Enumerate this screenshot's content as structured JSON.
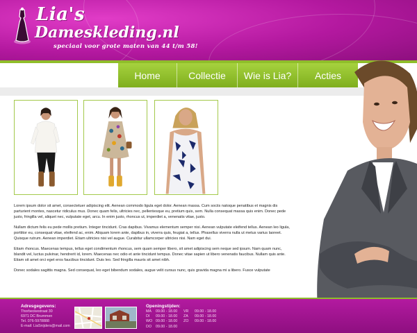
{
  "brand": {
    "name": "Lia's",
    "domain": "Dameskleding.nl",
    "tagline": "speciaal voor grote maten van 44 t/m 58!",
    "colors": {
      "primary": "#b3189f",
      "accent": "#8fbd2a"
    }
  },
  "nav": {
    "items": [
      {
        "label": "Home"
      },
      {
        "label": "Collectie"
      },
      {
        "label": "Wie is Lia?"
      },
      {
        "label": "Acties"
      }
    ]
  },
  "content": {
    "paragraphs": [
      "Lorem ipsum dolor sit amet, consectetuer adipiscing elit. Aenean commodo ligula eget dolor. Aenean massa. Cum sociis natoque penatibus et magnis dis parturient montes, nascetur ridiculus mus. Donec quam felis, ultricies nec, pellentesque eu, pretium quis, sem. Nulla consequat massa quis enim. Donec pede justo, fringilla vel, aliquet nec, vulputate eget, arcu. In enim justo, rhoncus ut, imperdiet a, venenatis vitae, justo.",
      "Nullam dictum felis eu pede mollis pretium. Integer tincidunt. Cras dapibus. Vivamus elementum semper nisi. Aenean vulputate eleifend tellus. Aenean leo ligula, porttitor eu, consequat vitae, eleifend ac, enim. Aliquam lorem ante, dapibus in, viverra quis, feugiat a, tellus. Phasellus viverra nulla ut metus varius laoreet. Quisque rutrum. Aenean imperdiet. Etiam ultricies nisi vel augue. Curabitur ullamcorper ultricies nisi. Nam eget dui.",
      "Etiam rhoncus. Maecenas tempus, tellus eget condimentum rhoncus, sem quam semper libero, sit amet adipiscing sem neque sed ipsum. Nam quam nunc, blandit vel, luctus pulvinar, hendrerit id, lorem. Maecenas nec odio et ante tincidunt tempus. Donec vitae sapien ut libero venenatis faucibus. Nullam quis ante. Etiam sit amet orci eget eros faucibus tincidunt. Duis leo. Sed fringilla mauris sit amet nibh.",
      "Donec sodales sagittis magna. Sed consequat, leo eget bibendum sodales, augue velit cursus nunc, quis gravida magna mi a libero. Fusce vulputate"
    ]
  },
  "footer": {
    "address": {
      "title": "Adresgegevens:",
      "lines": [
        "Thorbeckestraat 30",
        "6971 DC Brummen",
        "Tel. 076-5978888",
        "E-mail: LiaSnijders@mail.com"
      ]
    },
    "hours": {
      "title": "Openingstijden:",
      "rows": [
        [
          "MA",
          "09.00 - 18.00",
          "VR",
          "09.00 - 18.00"
        ],
        [
          "DI",
          "09.00 - 18.00",
          "ZA",
          "09.00 - 18.00"
        ],
        [
          "WO",
          "09.00 - 18.00",
          "ZO",
          "09.00 - 18.00"
        ],
        [
          "DO",
          "09.00 - 18.00",
          "",
          ""
        ]
      ]
    }
  }
}
